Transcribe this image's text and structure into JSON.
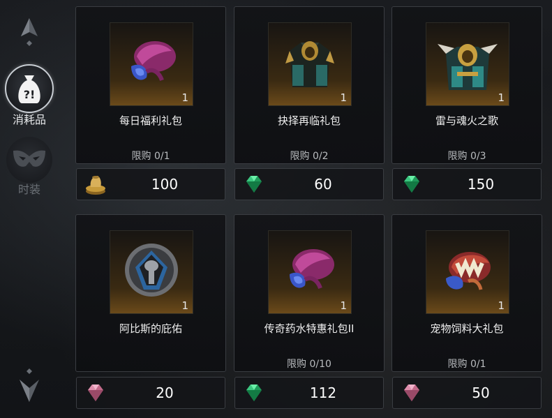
{
  "sidebar": {
    "items": [
      {
        "label": "消耗品",
        "active": true,
        "icon": "consumable-bag-icon"
      },
      {
        "label": "时装",
        "active": false,
        "icon": "mask-icon"
      }
    ]
  },
  "items": [
    {
      "name": "每日福利礼包",
      "qty": "1",
      "limit": "限购 0/1",
      "currency": "gold-coin-icon",
      "price": "100"
    },
    {
      "name": "抉择再临礼包",
      "qty": "1",
      "limit": "限购 0/2",
      "currency": "green-gem-icon",
      "price": "60"
    },
    {
      "name": "雷与魂火之歌",
      "qty": "1",
      "limit": "限购 0/3",
      "currency": "green-gem-icon",
      "price": "150"
    },
    {
      "name": "阿比斯的庇佑",
      "qty": "1",
      "limit": "",
      "currency": "pink-gem-icon",
      "price": "20"
    },
    {
      "name": "传奇药水特惠礼包II",
      "qty": "1",
      "limit": "限购 0/10",
      "currency": "green-gem-icon",
      "price": "112"
    },
    {
      "name": "宠物饲料大礼包",
      "qty": "1",
      "limit": "限购 0/1",
      "currency": "pink-gem-icon",
      "price": "50"
    }
  ]
}
